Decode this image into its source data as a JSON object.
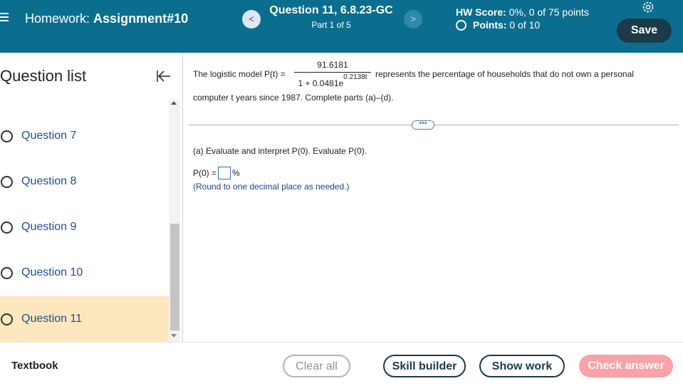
{
  "header": {
    "hw_label": "Homework:",
    "hw_name": "Assignment#10",
    "prev_label": "<",
    "next_label": ">",
    "question_title": "Question 11, 6.8.23-GC",
    "question_part": "Part 1 of 5",
    "score_label": "HW Score:",
    "score_value": "0%, 0 of 75 points",
    "points_label": "Points:",
    "points_value": "0 of 10",
    "save_label": "Save"
  },
  "sidebar": {
    "title": "Question list",
    "items": [
      {
        "label": "Question 7"
      },
      {
        "label": "Question 8"
      },
      {
        "label": "Question 9"
      },
      {
        "label": "Question 10"
      },
      {
        "label": "Question 11",
        "active": true
      }
    ]
  },
  "problem": {
    "intro": "The logistic model P(t) =",
    "numerator": "91.6181",
    "denominator_base": "1 + 0.0481e",
    "denominator_exp": "0.2138t",
    "rest": "represents the percentage of households that do not own a personal",
    "line2": "computer t years since 1987. Complete parts (a)–(d).",
    "ellipsis": "•••",
    "part_a": "(a) Evaluate and interpret P(0). Evaluate P(0).",
    "answer_prefix": "P(0) =",
    "answer_value": "",
    "answer_suffix": "%",
    "round_note": "(Round to one decimal place as needed.)"
  },
  "footer": {
    "textbook": "Textbook",
    "clear_all": "Clear all",
    "skill_builder": "Skill builder",
    "show_work": "Show work",
    "check_answer": "Check answer"
  },
  "colors": {
    "header_bg": "#0b6e8f",
    "active_item_bg": "#fde7bf",
    "link_blue": "#1f4e8f",
    "check_answer_bg": "#f7a3a7"
  }
}
